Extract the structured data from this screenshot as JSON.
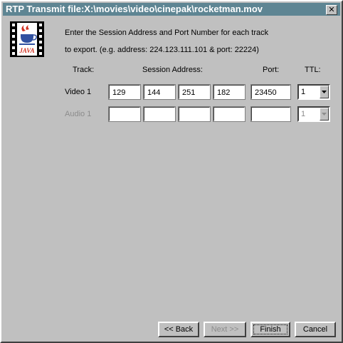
{
  "window": {
    "title": "RTP Transmit file:X:\\movies\\video\\cinepak\\rocketman.mov",
    "close_symbol": "✕"
  },
  "logo": {
    "text": "JAVA",
    "icon": "java-film-strip-icon"
  },
  "intro": {
    "line1": "Enter the Session Address and Port Number for each track",
    "line2": "to export. (e.g. address: 224.123.111.101 & port: 22224)"
  },
  "headers": {
    "track": "Track:",
    "session_address": "Session Address:",
    "port": "Port:",
    "ttl": "TTL:"
  },
  "tracks": [
    {
      "label": "Video 1",
      "enabled": true,
      "address": [
        "129",
        "144",
        "251",
        "182"
      ],
      "port": "23450",
      "ttl": "1"
    },
    {
      "label": "Audio 1",
      "enabled": false,
      "address": [
        "",
        "",
        "",
        ""
      ],
      "port": "",
      "ttl": "1"
    }
  ],
  "buttons": {
    "back": "<< Back",
    "next": "Next >>",
    "finish": "Finish",
    "cancel": "Cancel"
  },
  "colors": {
    "title_bar": "#5e8593",
    "dialog_bg": "#c0c0c0",
    "disabled_text": "#8c8c8c"
  }
}
